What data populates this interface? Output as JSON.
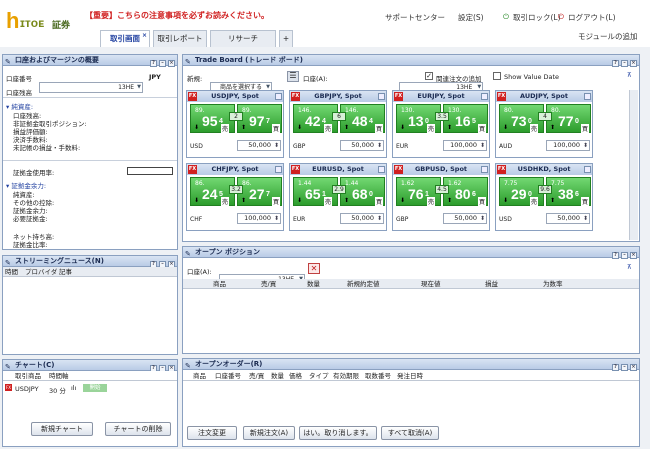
{
  "logo": {
    "h": "h",
    "rest": "ɪᴛᴏᴇ",
    "sub": "証券"
  },
  "notice": "【重要】こちらの注意事項を必ずお読みください。",
  "topnav": {
    "support": "サポートセンター",
    "settings": "設定(S)",
    "lock": "取引ロック(L)",
    "logout": "ログアウト(L)",
    "add_module": "モジュールの追加"
  },
  "tabs": [
    "取引画面",
    "取引レポート",
    "リサーチ",
    "+"
  ],
  "margin_panel": {
    "title": "口座およびマージンの概要",
    "account_label": "口座番号",
    "account_value": "13HE",
    "account_ccy": "JPY",
    "balance_label": "口座残高",
    "net_assets_label": "純資産:",
    "net_items": [
      "口座残高:",
      "非証拠金取引ポジション:",
      "損益評価額:",
      "決済手数料:",
      "未記帳の損益・手数料:"
    ],
    "usage_label": "証拠金使用率:",
    "capacity_label": "証拠金余力:",
    "cap_items": [
      "純資産:",
      "その他の控除:",
      "証拠金余力:",
      "必要証拠金:"
    ],
    "net_pos_label": "ネット持ち高:",
    "margin_ratio_label": "証拠金比率:"
  },
  "news_panel": {
    "title": "ストリーミングニュース(N)",
    "cols": [
      "時間",
      "プロバイダ",
      "記事"
    ]
  },
  "chart_panel": {
    "title": "チャート(C)",
    "cols": [
      "取引商品",
      "時間軸"
    ],
    "row": {
      "symbol": "USDJPY",
      "tf": "30 分",
      "badge": "開始"
    },
    "new_btn": "新規チャート",
    "del_btn": "チャートの削除"
  },
  "trade_board": {
    "title": "Trade Board (トレード ボード)",
    "new_label": "新規:",
    "select_placeholder": "商品を選択する",
    "account_label": "口座(A):",
    "account_value": "13HE",
    "related_label": "関連注文の追加",
    "value_date_label": "Show Value Date",
    "sell_label": "売",
    "buy_label": "買",
    "cards": [
      {
        "pair": "USDJPY, Spot",
        "bid_sm": "89.",
        "bid_big": "95",
        "bid_pip": "4",
        "ask_sm": "89.",
        "ask_big": "97",
        "ask_pip": "7",
        "spread": "2",
        "ccy": "USD",
        "amount": "50,000"
      },
      {
        "pair": "GBPJPY, Spot",
        "bid_sm": "146.",
        "bid_big": "42",
        "bid_pip": "4",
        "ask_sm": "146.",
        "ask_big": "48",
        "ask_pip": "4",
        "spread": "6",
        "ccy": "GBP",
        "amount": "50,000"
      },
      {
        "pair": "EURJPY, Spot",
        "bid_sm": "130.",
        "bid_big": "13",
        "bid_pip": "0",
        "ask_sm": "130.",
        "ask_big": "16",
        "ask_pip": "5",
        "spread": "3.5",
        "ccy": "EUR",
        "amount": "100,000"
      },
      {
        "pair": "AUDJPY, Spot",
        "bid_sm": "80.",
        "bid_big": "73",
        "bid_pip": "0",
        "ask_sm": "80.",
        "ask_big": "77",
        "ask_pip": "0",
        "spread": "4",
        "ccy": "AUD",
        "amount": "100,000"
      },
      {
        "pair": "CHFJPY, Spot",
        "bid_sm": "86.",
        "bid_big": "24",
        "bid_pip": "5",
        "ask_sm": "86.",
        "ask_big": "27",
        "ask_pip": "7",
        "spread": "3.2",
        "ccy": "CHF",
        "amount": "100,000"
      },
      {
        "pair": "EURUSD, Spot",
        "bid_sm": "1.44",
        "bid_big": "65",
        "bid_pip": "1",
        "ask_sm": "1.44",
        "ask_big": "68",
        "ask_pip": "0",
        "spread": "2.9",
        "ccy": "EUR",
        "amount": "50,000"
      },
      {
        "pair": "GBPUSD, Spot",
        "bid_sm": "1.62",
        "bid_big": "76",
        "bid_pip": "1",
        "ask_sm": "1.62",
        "ask_big": "80",
        "ask_pip": "6",
        "spread": "4.5",
        "ccy": "GBP",
        "amount": "50,000"
      },
      {
        "pair": "USDHKD, Spot",
        "bid_sm": "7.75",
        "bid_big": "29",
        "bid_pip": "0",
        "ask_sm": "7.75",
        "ask_big": "38",
        "ask_pip": "6",
        "spread": "9.6",
        "ccy": "USD",
        "amount": "50,000"
      }
    ]
  },
  "positions": {
    "title": "オープン ポジション",
    "account_label": "口座(A):",
    "account_value": "13HE",
    "cols": [
      "商品",
      "売/買",
      "数量",
      "新規約定値",
      "現在値",
      "損益",
      "为数率"
    ]
  },
  "orders": {
    "title": "オープンオーダー(R)",
    "cols": [
      "商品",
      "口座番号",
      "売/買",
      "数量",
      "価格",
      "タイプ",
      "有効期限",
      "取数番号",
      "発注日時"
    ],
    "btn_modify": "注文変更",
    "btn_new": "新規注文(A)",
    "btn_confirm": "はい。取り消します。",
    "btn_cancel_all": "すべて取消(A)"
  }
}
